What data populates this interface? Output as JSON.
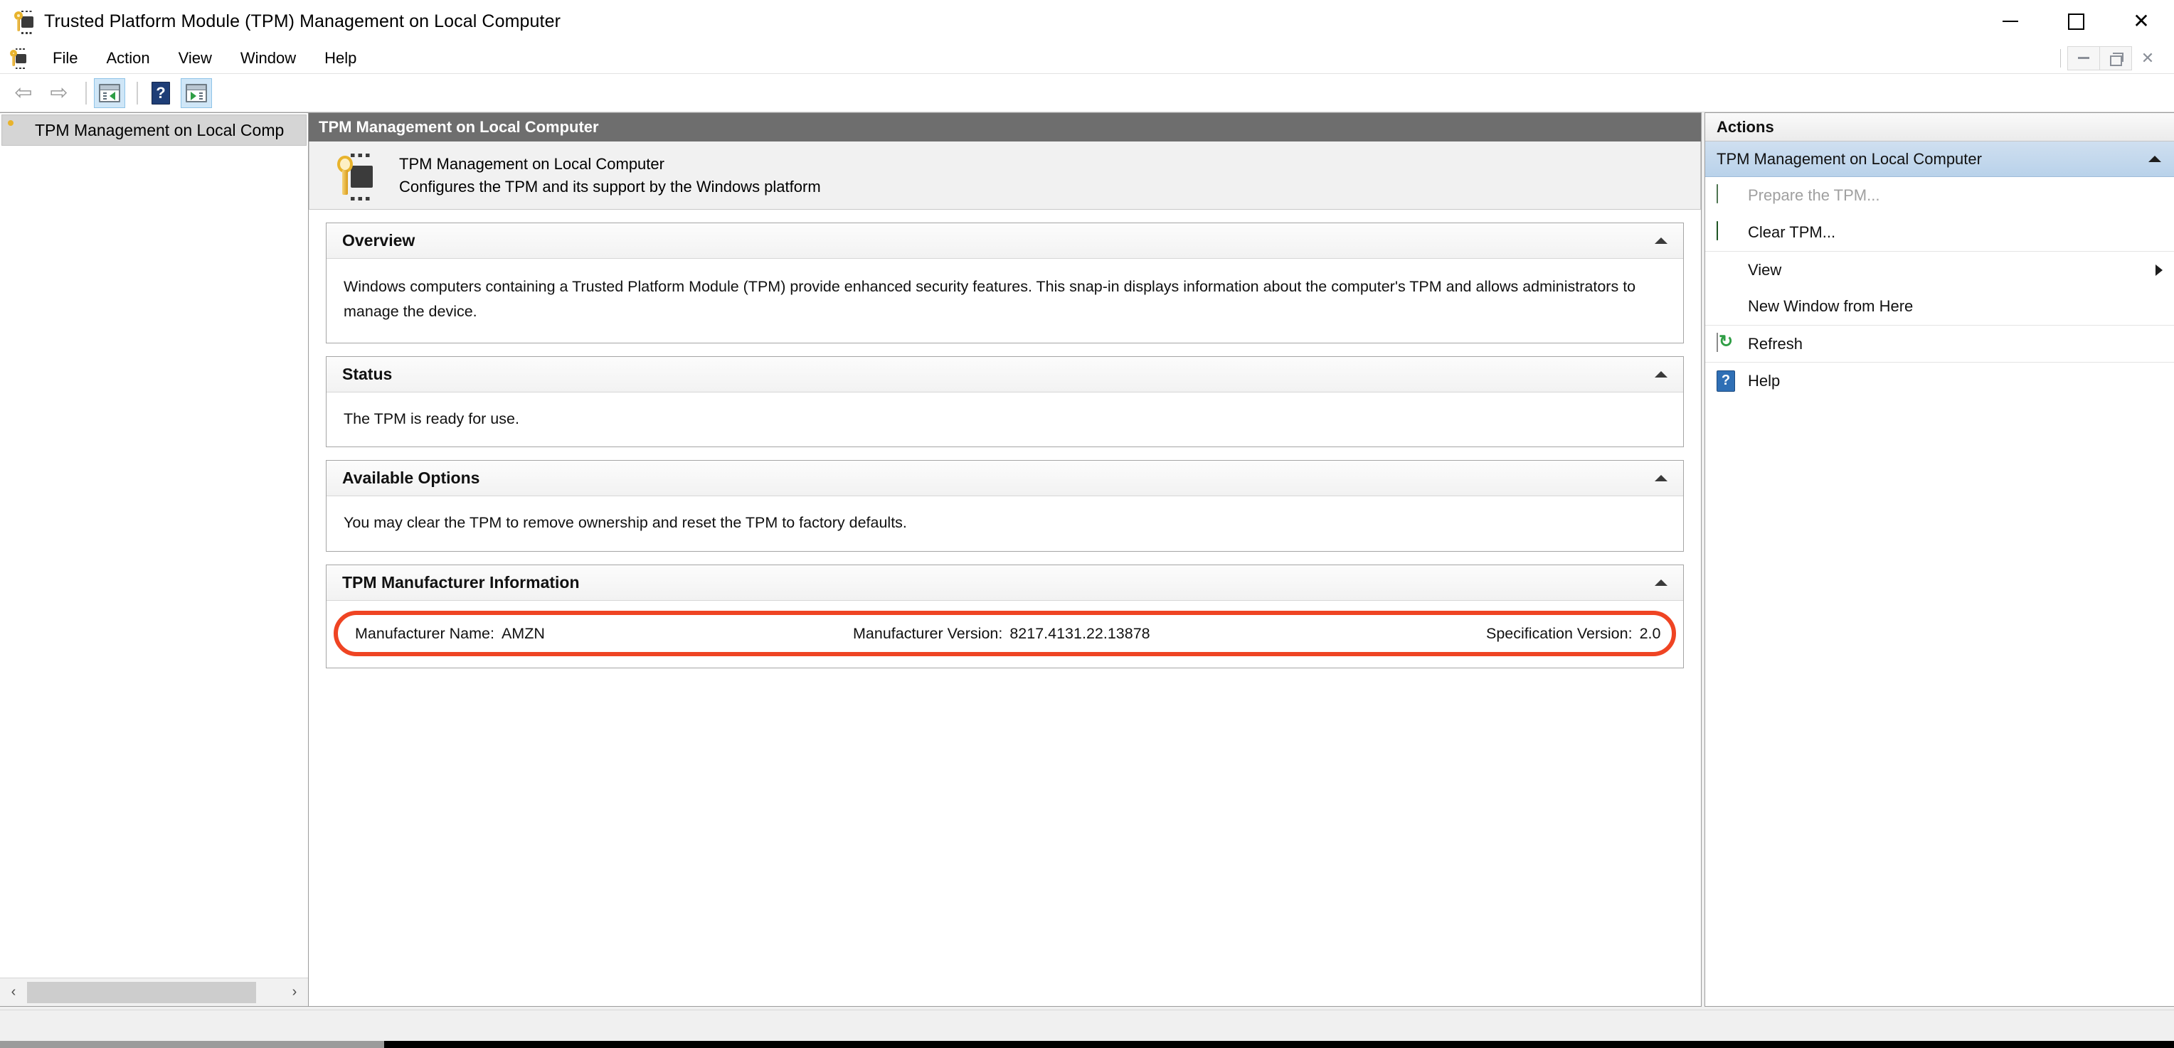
{
  "window": {
    "title": "Trusted Platform Module (TPM) Management on Local Computer",
    "app_icon": "tpm-key-chip-icon",
    "controls": {
      "minimize": "—",
      "maximize": "□",
      "close": "✕"
    }
  },
  "menubar": {
    "items": [
      {
        "label": "File"
      },
      {
        "label": "Action"
      },
      {
        "label": "View"
      },
      {
        "label": "Window"
      },
      {
        "label": "Help"
      }
    ],
    "mdi_controls": {
      "minimize": "minimize-icon",
      "restore": "restore-icon",
      "close": "✕"
    }
  },
  "toolbar": {
    "buttons": [
      {
        "name": "back-button",
        "icon": "arrow-left-icon",
        "glyph": "⇦",
        "enabled": false
      },
      {
        "name": "forward-button",
        "icon": "arrow-right-icon",
        "glyph": "⇨",
        "enabled": false
      },
      {
        "name": "show-console-tree-button",
        "icon": "console-tree-pane-icon",
        "toggled": true
      },
      {
        "name": "help-button",
        "icon": "help-question-icon",
        "glyph": "?",
        "toggled": false
      },
      {
        "name": "show-action-pane-button",
        "icon": "action-pane-icon",
        "toggled": true
      }
    ]
  },
  "tree": {
    "items": [
      {
        "label": "TPM Management on Local Comp",
        "icon": "tpm-key-chip-icon",
        "selected": true
      }
    ],
    "scrollbar": {
      "left_arrow": "‹",
      "right_arrow": "›"
    }
  },
  "content": {
    "caption": "TPM Management on Local Computer",
    "header": {
      "icon": "tpm-key-chip-icon",
      "title": "TPM Management on Local Computer",
      "subtitle": "Configures the TPM and its support by the Windows platform"
    },
    "sections": [
      {
        "id": "overview",
        "title": "Overview",
        "collapse_icon": "chevron-up-icon",
        "body": "Windows computers containing a Trusted Platform Module (TPM) provide enhanced security features. This snap-in displays information about the computer's TPM and allows administrators to manage the device."
      },
      {
        "id": "status",
        "title": "Status",
        "collapse_icon": "chevron-up-icon",
        "body": "The TPM is ready for use."
      },
      {
        "id": "available-options",
        "title": "Available Options",
        "collapse_icon": "chevron-up-icon",
        "body": "You may clear the TPM to remove ownership and reset the TPM to factory defaults."
      }
    ],
    "manufacturer_section": {
      "id": "tpm-manufacturer-information",
      "title": "TPM Manufacturer Information",
      "collapse_icon": "chevron-up-icon",
      "highlight_color": "#ef4423",
      "fields": [
        {
          "label": "Manufacturer Name:",
          "value": "AMZN"
        },
        {
          "label": "Manufacturer Version:",
          "value": "8217.4131.22.13878"
        },
        {
          "label": "Specification Version:",
          "value": "2.0"
        }
      ]
    }
  },
  "actions": {
    "caption": "Actions",
    "group": {
      "title": "TPM Management on Local Computer",
      "collapse_icon": "chevron-up-icon"
    },
    "items": [
      {
        "label": "Prepare the TPM...",
        "icon": "green-arrow-icon",
        "enabled": false,
        "separator_above": false,
        "submenu": false
      },
      {
        "label": "Clear TPM...",
        "icon": "green-arrow-icon",
        "enabled": true,
        "separator_above": false,
        "submenu": false
      },
      {
        "label": "View",
        "icon": "none",
        "enabled": true,
        "separator_above": true,
        "submenu": true
      },
      {
        "label": "New Window from Here",
        "icon": "none",
        "enabled": true,
        "separator_above": false,
        "submenu": false
      },
      {
        "label": "Refresh",
        "icon": "refresh-icon",
        "enabled": true,
        "separator_above": true,
        "submenu": false
      },
      {
        "label": "Help",
        "icon": "help-question-icon",
        "enabled": true,
        "separator_above": true,
        "submenu": false
      }
    ]
  }
}
